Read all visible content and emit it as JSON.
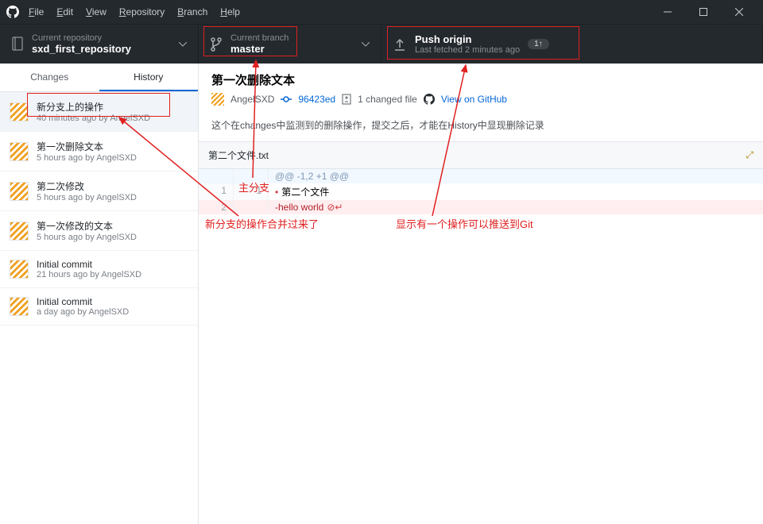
{
  "menu": {
    "file": "File",
    "edit": "Edit",
    "view": "View",
    "repository": "Repository",
    "branch": "Branch",
    "help": "Help"
  },
  "toolbar": {
    "repo": {
      "label": "Current repository",
      "name": "sxd_first_repository"
    },
    "branch": {
      "label": "Current branch",
      "name": "master"
    },
    "push": {
      "label": "Push origin",
      "sub": "Last fetched 2 minutes ago",
      "badge": "1↑"
    }
  },
  "tabs": {
    "changes": "Changes",
    "history": "History"
  },
  "commits": [
    {
      "title": "新分支上的操作",
      "meta": "40 minutes ago by AngelSXD"
    },
    {
      "title": "第一次删除文本",
      "meta": "5 hours ago by AngelSXD"
    },
    {
      "title": "第二次修改",
      "meta": "5 hours ago by AngelSXD"
    },
    {
      "title": "第一次修改的文本",
      "meta": "5 hours ago by AngelSXD"
    },
    {
      "title": "Initial commit",
      "meta": "21 hours ago by AngelSXD"
    },
    {
      "title": "Initial commit",
      "meta": "a day ago by AngelSXD"
    }
  ],
  "commit_view": {
    "title": "第一次删除文本",
    "author": "AngelSXD",
    "sha": "96423ed",
    "changed": "1 changed file",
    "github": "View on GitHub",
    "desc": "这个在changes中监测到的删除操作，提交之后，才能在History中显现删除记录",
    "filename": "第二个文件.txt"
  },
  "diff": {
    "hunk": "@@ -1,2 +1 @@",
    "ctx_old": "1",
    "ctx_new": "1",
    "ctx_code": "第二个文件",
    "del_old": "2",
    "del_code": "-hello world"
  },
  "annotations": {
    "branch_label": "主分支",
    "merge_label": "新分支的操作合并过来了",
    "push_label": "显示有一个操作可以推送到Git"
  }
}
